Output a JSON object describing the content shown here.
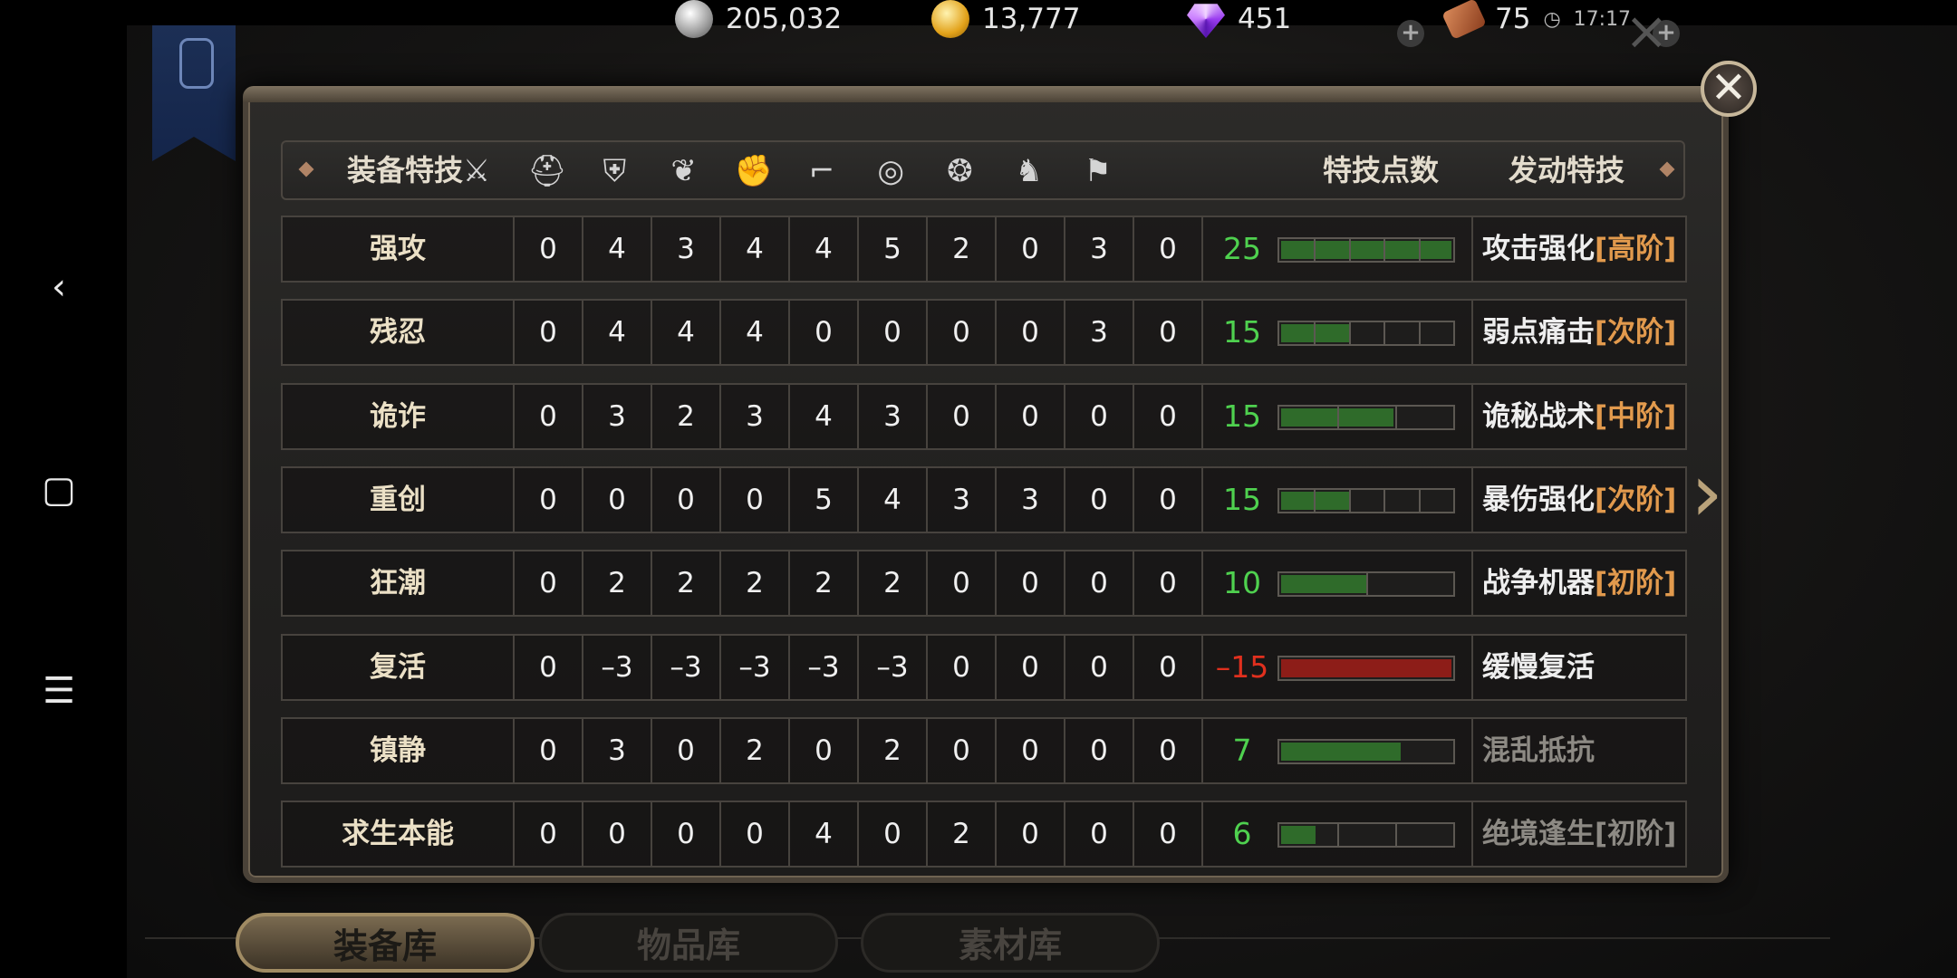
{
  "currency": {
    "silver": "205,032",
    "gold": "13,777",
    "gems": "451",
    "tickets": "75",
    "timer": "17:17"
  },
  "header": {
    "col_skill": "装备特技",
    "col_points": "特技点数",
    "col_active": "发动特技",
    "slot_icons": [
      "sword-icon",
      "helmet-icon",
      "chest-armor-icon",
      "shoulder-icon",
      "gauntlet-icon",
      "boots-icon",
      "ring-icon",
      "amulet-icon",
      "horse-icon",
      "banner-icon"
    ]
  },
  "rows": [
    {
      "name": "强攻",
      "v": [
        "0",
        "4",
        "3",
        "4",
        "4",
        "5",
        "2",
        "0",
        "3",
        "0"
      ],
      "points": "25",
      "level": 1.0,
      "segments": 5,
      "filled_segments": 4,
      "negative": false,
      "skill": "攻击强化",
      "tier": "[高阶]",
      "dim": false
    },
    {
      "name": "残忍",
      "v": [
        "0",
        "4",
        "4",
        "4",
        "0",
        "0",
        "0",
        "0",
        "3",
        "0"
      ],
      "points": "15",
      "level": 0.4,
      "segments": 5,
      "filled_segments": 2,
      "negative": false,
      "skill": "弱点痛击",
      "tier": "[次阶]",
      "dim": false
    },
    {
      "name": "诡诈",
      "v": [
        "0",
        "3",
        "2",
        "3",
        "4",
        "3",
        "0",
        "0",
        "0",
        "0"
      ],
      "points": "15",
      "level": 0.66,
      "segments": 3,
      "filled_segments": 2,
      "negative": false,
      "skill": "诡秘战术",
      "tier": "[中阶]",
      "dim": false
    },
    {
      "name": "重创",
      "v": [
        "0",
        "0",
        "0",
        "0",
        "5",
        "4",
        "3",
        "3",
        "0",
        "0"
      ],
      "points": "15",
      "level": 0.4,
      "segments": 5,
      "filled_segments": 2,
      "negative": false,
      "skill": "暴伤强化",
      "tier": "[次阶]",
      "dim": false
    },
    {
      "name": "狂潮",
      "v": [
        "0",
        "2",
        "2",
        "2",
        "2",
        "2",
        "0",
        "0",
        "0",
        "0"
      ],
      "points": "10",
      "level": 0.5,
      "segments": 2,
      "filled_segments": 1,
      "negative": false,
      "skill": "战争机器",
      "tier": "[初阶]",
      "dim": false
    },
    {
      "name": "复活",
      "v": [
        "0",
        "–3",
        "–3",
        "–3",
        "–3",
        "–3",
        "0",
        "0",
        "0",
        "0"
      ],
      "points": "–15",
      "level": 1.0,
      "segments": 1,
      "filled_segments": 1,
      "negative": true,
      "skill": "缓慢复活",
      "tier": "",
      "dim": false
    },
    {
      "name": "镇静",
      "v": [
        "0",
        "3",
        "0",
        "2",
        "0",
        "2",
        "0",
        "0",
        "0",
        "0"
      ],
      "points": "7",
      "level": 0.7,
      "segments": 1,
      "filled_segments": 1,
      "negative": false,
      "skill": "混乱抵抗",
      "tier": "",
      "dim": true
    },
    {
      "name": "求生本能",
      "v": [
        "0",
        "0",
        "0",
        "0",
        "4",
        "0",
        "2",
        "0",
        "0",
        "0"
      ],
      "points": "6",
      "level": 0.2,
      "segments": 3,
      "filled_segments": 1,
      "negative": false,
      "skill": "绝境逢生",
      "tier": "[初阶]",
      "dim": true
    }
  ],
  "tabs": [
    {
      "label": "装备库",
      "active": true
    },
    {
      "label": "物品库",
      "active": false
    },
    {
      "label": "素材库",
      "active": false
    }
  ],
  "colors": {
    "positive": "#4fd14f",
    "negative": "#e0301e",
    "tier": "#e29a4d",
    "bar_green": "#2f6b2a",
    "bar_red": "#8d1d18"
  }
}
